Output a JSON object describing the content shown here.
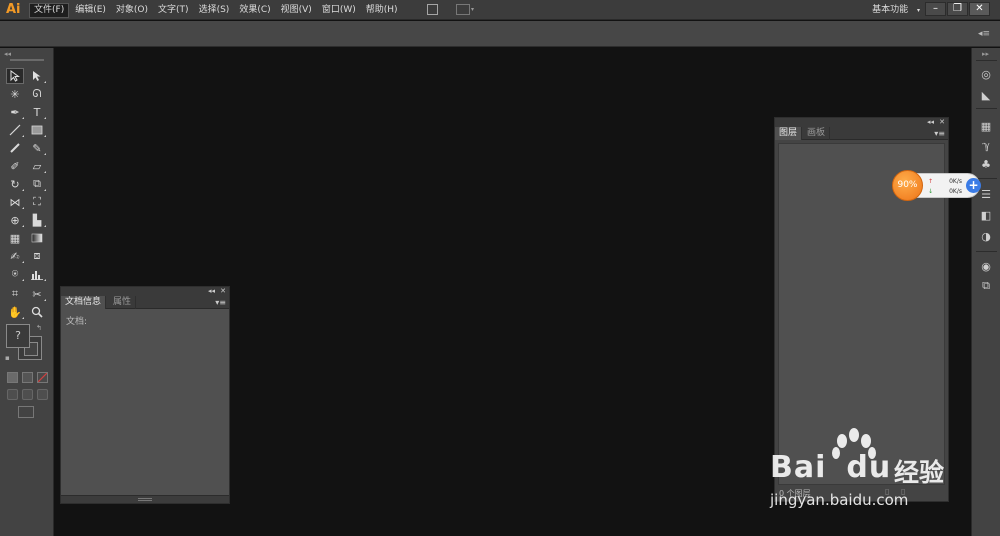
{
  "app": {
    "logo": "Ai"
  },
  "menubar": {
    "items": [
      {
        "label": "文件(F)"
      },
      {
        "label": "编辑(E)"
      },
      {
        "label": "对象(O)"
      },
      {
        "label": "文字(T)"
      },
      {
        "label": "选择(S)"
      },
      {
        "label": "效果(C)"
      },
      {
        "label": "视图(V)"
      },
      {
        "label": "窗口(W)"
      },
      {
        "label": "帮助(H)"
      }
    ],
    "workspace": "基本功能",
    "window_buttons": {
      "minimize": "–",
      "restore": "❐",
      "close": "✕"
    }
  },
  "controlbar": {
    "menu_icon": "panel-menu-icon"
  },
  "toolbar": {
    "fill_stroke_placeholder": "?",
    "tools": [
      "selection-tool",
      "direct-selection-tool",
      "magic-wand-tool",
      "lasso-tool",
      "pen-tool",
      "type-tool",
      "line-segment-tool",
      "rectangle-tool",
      "paintbrush-tool",
      "pencil-tool",
      "blob-brush-tool",
      "eraser-tool",
      "rotate-tool",
      "scale-tool",
      "width-tool",
      "free-transform-tool",
      "shape-builder-tool",
      "perspective-grid-tool",
      "mesh-tool",
      "gradient-tool",
      "eyedropper-tool",
      "blend-tool",
      "symbol-sprayer-tool",
      "column-graph-tool",
      "artboard-tool",
      "slice-tool",
      "hand-tool",
      "zoom-tool"
    ]
  },
  "doc_info_panel": {
    "tabs": [
      {
        "label": "文档信息",
        "active": true
      },
      {
        "label": "属性",
        "active": false
      }
    ],
    "body_label": "文档:"
  },
  "layers_panel": {
    "tabs": [
      {
        "label": "图层",
        "active": true
      },
      {
        "label": "画板",
        "active": false
      }
    ],
    "footer_label": "0 个图层"
  },
  "speed_widget": {
    "percent": "90%",
    "upload": "0K/s",
    "download": "0K/s",
    "plus": "+"
  },
  "watermark": {
    "brand": "Bai",
    "brand_suffix": "du",
    "jingyan": "经验",
    "url": "jingyan.baidu.com"
  },
  "colors": {
    "accent_orange": "#f39a26",
    "canvas": "#121212",
    "panel": "#505050",
    "speed_blue": "#3b7ce6"
  }
}
